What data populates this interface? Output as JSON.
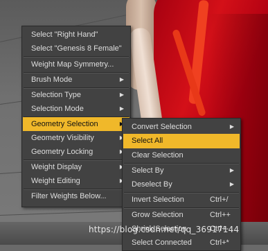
{
  "main_menu": {
    "items": [
      {
        "label": "Select \"Right Hand\"",
        "has_submenu": false
      },
      {
        "label": "Select \"Genesis 8 Female\"",
        "has_submenu": false
      },
      {
        "label": "Weight Map Symmetry...",
        "has_submenu": false
      },
      {
        "label": "Brush Mode",
        "has_submenu": true
      },
      {
        "label": "Selection Type",
        "has_submenu": true
      },
      {
        "label": "Selection Mode",
        "has_submenu": true
      },
      {
        "label": "Geometry Selection",
        "has_submenu": true,
        "highlighted": true
      },
      {
        "label": "Geometry Visibility",
        "has_submenu": true
      },
      {
        "label": "Geometry Locking",
        "has_submenu": true
      },
      {
        "label": "Weight Display",
        "has_submenu": true
      },
      {
        "label": "Weight Editing",
        "has_submenu": true
      },
      {
        "label": "Filter Weights Below...",
        "has_submenu": false
      }
    ]
  },
  "sub_menu": {
    "items": [
      {
        "label": "Convert Selection",
        "has_submenu": true,
        "shortcut": ""
      },
      {
        "label": "Select All",
        "has_submenu": false,
        "shortcut": "",
        "highlighted": true
      },
      {
        "label": "Clear Selection",
        "has_submenu": false,
        "shortcut": ""
      },
      {
        "label": "Select By",
        "has_submenu": true,
        "shortcut": ""
      },
      {
        "label": "Deselect By",
        "has_submenu": true,
        "shortcut": ""
      },
      {
        "label": "Invert Selection",
        "has_submenu": false,
        "shortcut": "Ctrl+/"
      },
      {
        "label": "Grow Selection",
        "has_submenu": false,
        "shortcut": "Ctrl++"
      },
      {
        "label": "Shrink Selection",
        "has_submenu": false,
        "shortcut": "Ctrl+-"
      },
      {
        "label": "Select Connected",
        "has_submenu": false,
        "shortcut": "Ctrl+*"
      }
    ]
  },
  "arrow_glyph": "▶",
  "watermark": "https://blog.csdn.net/qq_36917144",
  "colors": {
    "highlight": "#f0b82a",
    "menu_bg": "#424242",
    "menu_text": "#dedede",
    "dress": "#d41018"
  }
}
